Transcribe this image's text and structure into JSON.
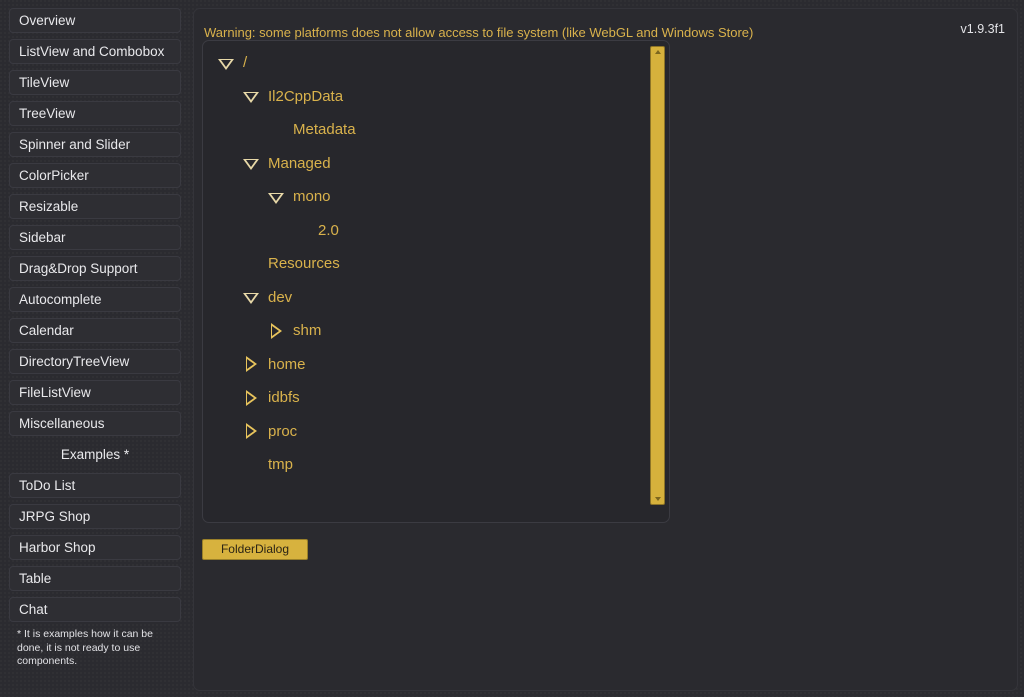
{
  "sidebar": {
    "items": [
      {
        "label": "Overview"
      },
      {
        "label": "ListView and Combobox"
      },
      {
        "label": "TileView"
      },
      {
        "label": "TreeView"
      },
      {
        "label": "Spinner and Slider"
      },
      {
        "label": "ColorPicker"
      },
      {
        "label": "Resizable"
      },
      {
        "label": "Sidebar"
      },
      {
        "label": "Drag&Drop Support"
      },
      {
        "label": "Autocomplete"
      },
      {
        "label": "Calendar"
      },
      {
        "label": "DirectoryTreeView"
      },
      {
        "label": "FileListView"
      },
      {
        "label": "Miscellaneous"
      }
    ],
    "examples_header": "Examples *",
    "examples": [
      {
        "label": "ToDo List"
      },
      {
        "label": "JRPG Shop"
      },
      {
        "label": "Harbor Shop"
      },
      {
        "label": "Table"
      },
      {
        "label": "Chat"
      }
    ],
    "footnote": "* It is examples how it can be done, it is not ready to use components."
  },
  "main": {
    "warning": "Warning: some platforms does not allow access to file system (like WebGL and Windows Store)",
    "version": "v1.9.3f1",
    "folder_dialog_label": "FolderDialog"
  },
  "tree": {
    "nodes": [
      {
        "label": "/",
        "depth": 0,
        "state": "expanded"
      },
      {
        "label": "Il2CppData",
        "depth": 1,
        "state": "expanded"
      },
      {
        "label": "Metadata",
        "depth": 2,
        "state": "leaf"
      },
      {
        "label": "Managed",
        "depth": 1,
        "state": "expanded"
      },
      {
        "label": "mono",
        "depth": 2,
        "state": "expanded"
      },
      {
        "label": "2.0",
        "depth": 3,
        "state": "leaf"
      },
      {
        "label": "Resources",
        "depth": 1,
        "state": "leaf"
      },
      {
        "label": "dev",
        "depth": 1,
        "state": "expanded"
      },
      {
        "label": "shm",
        "depth": 2,
        "state": "collapsed"
      },
      {
        "label": "home",
        "depth": 1,
        "state": "collapsed"
      },
      {
        "label": "idbfs",
        "depth": 1,
        "state": "collapsed"
      },
      {
        "label": "proc",
        "depth": 1,
        "state": "collapsed"
      },
      {
        "label": "tmp",
        "depth": 1,
        "state": "leaf"
      }
    ],
    "scrollbar": {
      "up_arrow": "scroll-up-arrow",
      "down_arrow": "scroll-down-arrow"
    }
  },
  "colors": {
    "accent_gold": "#d9b24c",
    "scroll_thumb": "#d6b13c",
    "panel_bg": "#2a2a2f",
    "tree_bg": "#27272c",
    "page_bg": "#2b2b30"
  }
}
